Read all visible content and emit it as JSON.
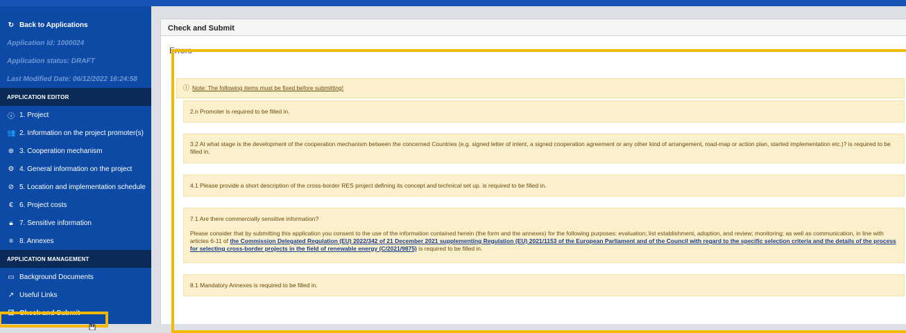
{
  "sidebar": {
    "back_label": "Back to Applications",
    "application_id": "Application Id: 1000024",
    "application_status": "Application status: DRAFT",
    "last_modified": "Last Modified Date: 06/12/2022 16:24:58",
    "editor_section": "APPLICATION EDITOR",
    "editor_items": [
      {
        "label": "1. Project",
        "icon": "info-circle-icon"
      },
      {
        "label": "2. Information on the project promoter(s)",
        "icon": "users-icon"
      },
      {
        "label": "3. Cooperation mechanism",
        "icon": "globe-icon"
      },
      {
        "label": "4. General information on the project",
        "icon": "gear-icon"
      },
      {
        "label": "5. Location and implementation schedule",
        "icon": "compass-icon"
      },
      {
        "label": "6. Project costs",
        "icon": "euro-icon"
      },
      {
        "label": "7. Sensitive information",
        "icon": "lock-icon"
      },
      {
        "label": "8. Annexes",
        "icon": "list-icon"
      }
    ],
    "management_section": "APPLICATION MANAGEMENT",
    "management_items": [
      {
        "label": "Background Documents",
        "icon": "folder-icon"
      },
      {
        "label": "Useful Links",
        "icon": "external-link-icon"
      },
      {
        "label": "Check and Submit",
        "icon": "checkbox-icon"
      }
    ]
  },
  "main": {
    "page_title": "Check and Submit",
    "errors_title": "Errors",
    "note": "Note: The following items must be fixed before submitting!",
    "errors": [
      "2.n Promoter is required to be filled in.",
      "3.2 At what stage is the development of the cooperation mechanism between the concerned Countries (e.g. signed letter of intent, a signed cooperation agreement or any other kind of arrangement, road-map or action plan, started implementation etc.)? is required to be filled in.",
      "4.1 Please provide a short description of the cross-border RES project defining its concept and technical set up. is required to be filled in.",
      "8.1 Mandatory Annexes is required to be filled in."
    ],
    "sensitive_error": {
      "question": "7.1 Are there commercially sensitive information?",
      "consent_prefix": "Please consider that by submitting this application you consent to the use of the information contained herein (the form and the annexes) for the following purposes: evaluation; list establishment, adoption, and review; monitoring; as well as communication, in line with articles 6-11 of",
      "link_text": "the Commission Delegated Regulation (EU) 2022/342 of 21 December 2021 supplementing Regulation (EU) 2021/1153 of the European Parliament and of the Council with regard to the specific selection criteria and the details of the process for selecting cross-border projects in the field of renewable energy (C/2021/9875)",
      "suffix": "is required to be filled in."
    }
  },
  "colors": {
    "sidebar_bg": "#0c4aa5",
    "section_bg": "#0a2a57",
    "highlight": "#f5b800",
    "error_bg": "#fbf0cc",
    "error_text": "#6b4a0e"
  }
}
